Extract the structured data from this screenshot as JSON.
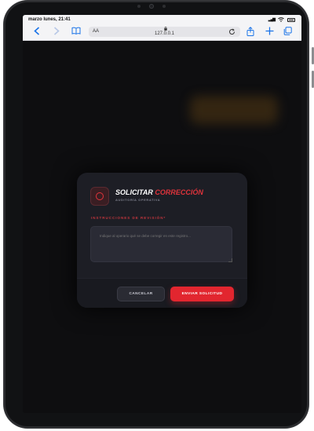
{
  "statusbar": {
    "time": "marzo lunes, 21:41",
    "signal_icon": "signal-icon",
    "wifi_icon": "wifi-icon",
    "battery_icon": "battery-icon"
  },
  "browser": {
    "back_icon": "‹",
    "forward_icon": "›",
    "bookmarks_icon": "book-icon",
    "text_size_label": "AA",
    "url": "127.0.0.1",
    "reload_icon": "reload-icon",
    "share_icon": "share-icon",
    "new_tab_icon": "plus-icon",
    "tabs_icon": "tabs-icon"
  },
  "modal": {
    "title_main": "SOLICITAR",
    "title_accent": "CORRECCIÓN",
    "subtitle": "AUDITORÍA OPERATIVA",
    "field_label": "INSTRUCCIONES DE REVISIÓN*",
    "textarea_placeholder": "Indique al operario qué se debe corregir en este registro...",
    "cancel_label": "CANCELAR",
    "send_label": "ENVIAR SOLICITUD",
    "accent_color": "#e0333b",
    "icon": "circle-icon"
  }
}
